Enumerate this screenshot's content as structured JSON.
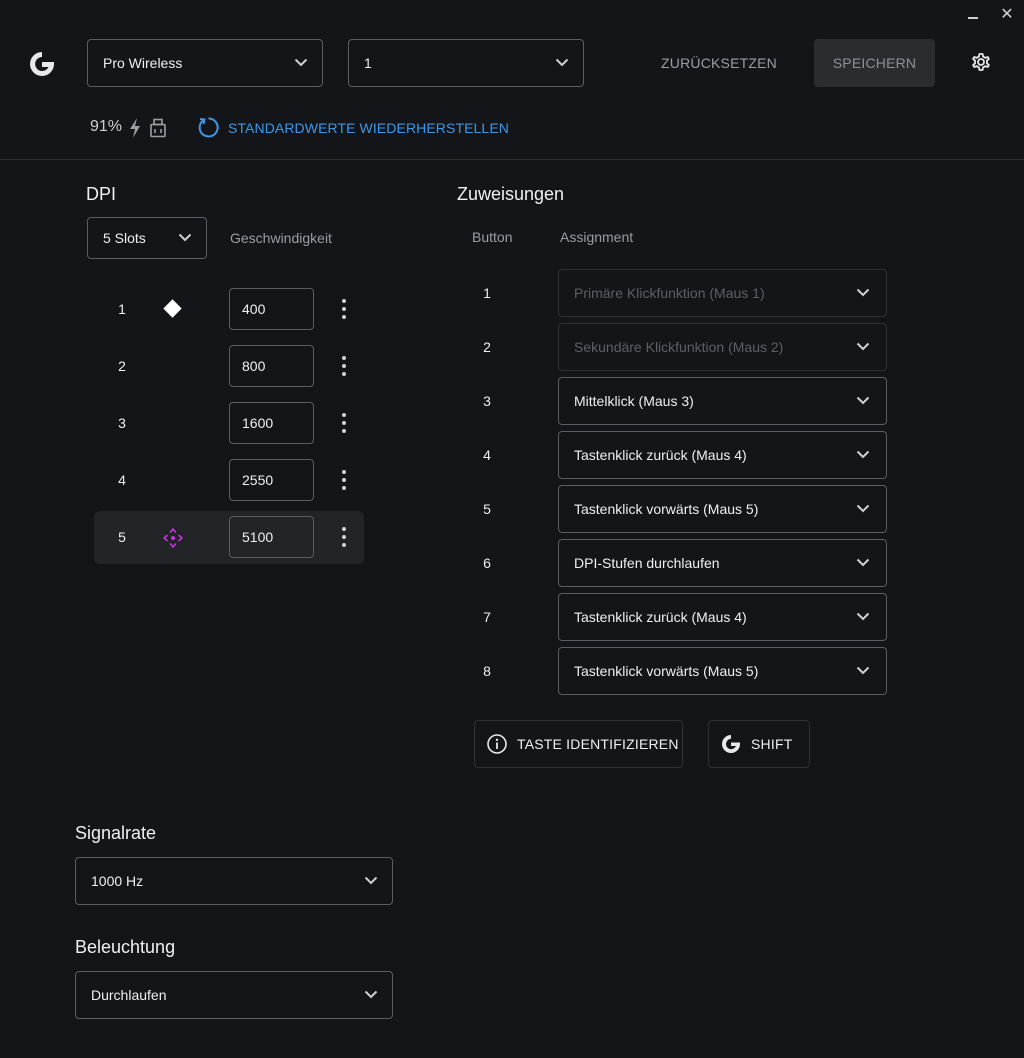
{
  "window": {
    "minimize_icon": "minimize-icon",
    "close_symbol": "✕"
  },
  "header": {
    "device": "Pro Wireless",
    "profile": "1",
    "reset_label": "ZURÜCKSETZEN",
    "save_label": "SPEICHERN",
    "battery": "91%",
    "restore_label": "STANDARDWERTE WIEDERHERSTELLEN"
  },
  "dpi": {
    "title": "DPI",
    "slots": "5 Slots",
    "speed_label": "Geschwindigkeit",
    "rows": [
      {
        "num": "1",
        "value": "400"
      },
      {
        "num": "2",
        "value": "800"
      },
      {
        "num": "3",
        "value": "1600"
      },
      {
        "num": "4",
        "value": "2550"
      },
      {
        "num": "5",
        "value": "5100"
      }
    ]
  },
  "assignments": {
    "title": "Zuweisungen",
    "col_button": "Button",
    "col_assignment": "Assignment",
    "rows": [
      {
        "num": "1",
        "value": "Primäre Klickfunktion (Maus 1)"
      },
      {
        "num": "2",
        "value": "Sekundäre Klickfunktion (Maus 2)"
      },
      {
        "num": "3",
        "value": "Mittelklick (Maus 3)"
      },
      {
        "num": "4",
        "value": "Tastenklick zurück (Maus 4)"
      },
      {
        "num": "5",
        "value": "Tastenklick vorwärts (Maus 5)"
      },
      {
        "num": "6",
        "value": "DPI-Stufen durchlaufen"
      },
      {
        "num": "7",
        "value": "Tastenklick zurück (Maus 4)"
      },
      {
        "num": "8",
        "value": "Tastenklick vorwärts (Maus 5)"
      }
    ],
    "identify_label": "TASTE IDENTIFIZIEREN",
    "shift_label": "SHIFT"
  },
  "signal": {
    "title": "Signalrate",
    "value": "1000 Hz"
  },
  "lighting": {
    "title": "Beleuchtung",
    "value": "Durchlaufen"
  },
  "colors": {
    "accent_blue": "#3d98e8",
    "shift_purple": "#c933e6",
    "background": "#141518"
  }
}
